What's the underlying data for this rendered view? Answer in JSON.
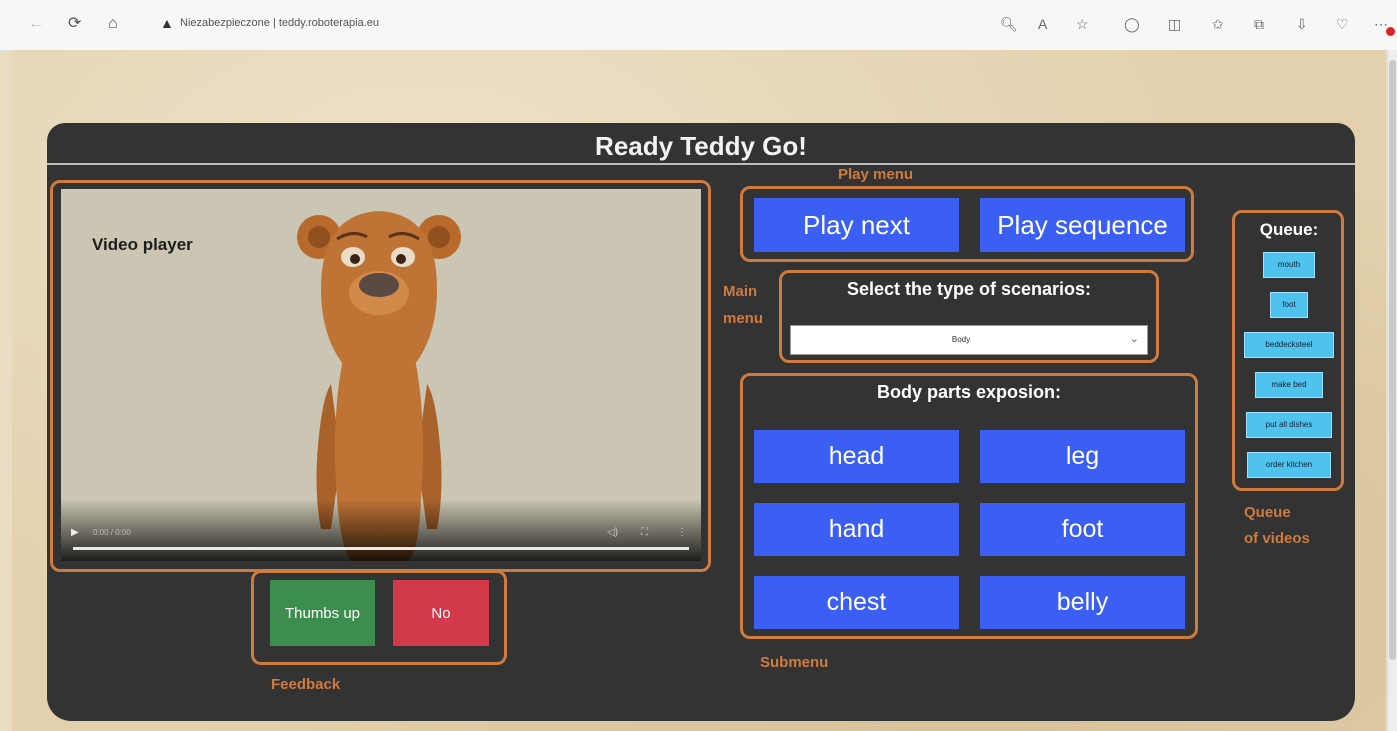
{
  "browser": {
    "security_label": "Niezabezpieczone",
    "url": "teddy.roboterapia.eu"
  },
  "app": {
    "title": "Ready Teddy Go!"
  },
  "annotations": {
    "play_menu": "Play menu",
    "main_menu": [
      "Main",
      "menu"
    ],
    "submenu": "Submenu",
    "feedback": "Feedback",
    "queue_of_videos": [
      "Queue",
      "of videos"
    ]
  },
  "video": {
    "label": "Video player",
    "time": "0:00 / 0:00"
  },
  "feedback": {
    "thumbs_up": "Thumbs up",
    "no": "No"
  },
  "play_menu": {
    "play_next": "Play next",
    "play_sequence": "Play sequence"
  },
  "main_menu": {
    "heading": "Select the type of scenarios:",
    "selected": "Body"
  },
  "submenu": {
    "heading": "Body parts exposion:",
    "parts": [
      "head",
      "leg",
      "hand",
      "foot",
      "chest",
      "belly"
    ]
  },
  "queue": {
    "title": "Queue:",
    "items": [
      "mouth",
      "foot",
      "beddecksteel",
      "make bed",
      "put all dishes",
      "order kitchen"
    ]
  },
  "colors": {
    "accent_orange": "#cd7b3f",
    "button_blue": "#3b5ff3",
    "queue_blue": "#4fc3ee",
    "thumbs_green": "#3d8d4f",
    "no_red": "#d23a4c",
    "panel_bg": "#333333"
  }
}
